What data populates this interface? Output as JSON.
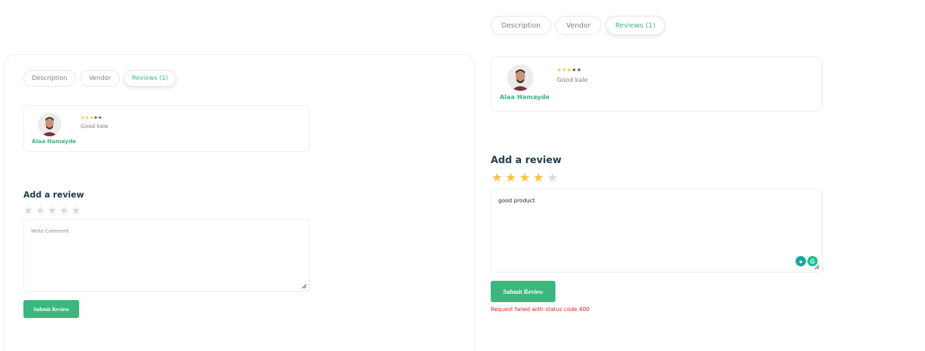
{
  "tabs": [
    {
      "label": "Description"
    },
    {
      "label": "Vendor"
    },
    {
      "label": "Reviews (1)"
    }
  ],
  "colors": {
    "accent": "#3bb77e",
    "star_filled": "#fdc040",
    "star_empty": "#dadada",
    "error": "#e3261c"
  },
  "review": {
    "reviewer_name": "Alaa Hamayde",
    "rating": 3,
    "max_rating": 5,
    "text": "Good kale"
  },
  "left_form": {
    "title": "Add a review",
    "rating": 0,
    "comment_value": "",
    "comment_placeholder": "Write Comment",
    "submit_label": "Submit Review"
  },
  "right_form": {
    "title": "Add a review",
    "rating": 4,
    "comment_value": "good product",
    "submit_label": "Submit Review",
    "error_message": "Request failed with status code 400"
  }
}
